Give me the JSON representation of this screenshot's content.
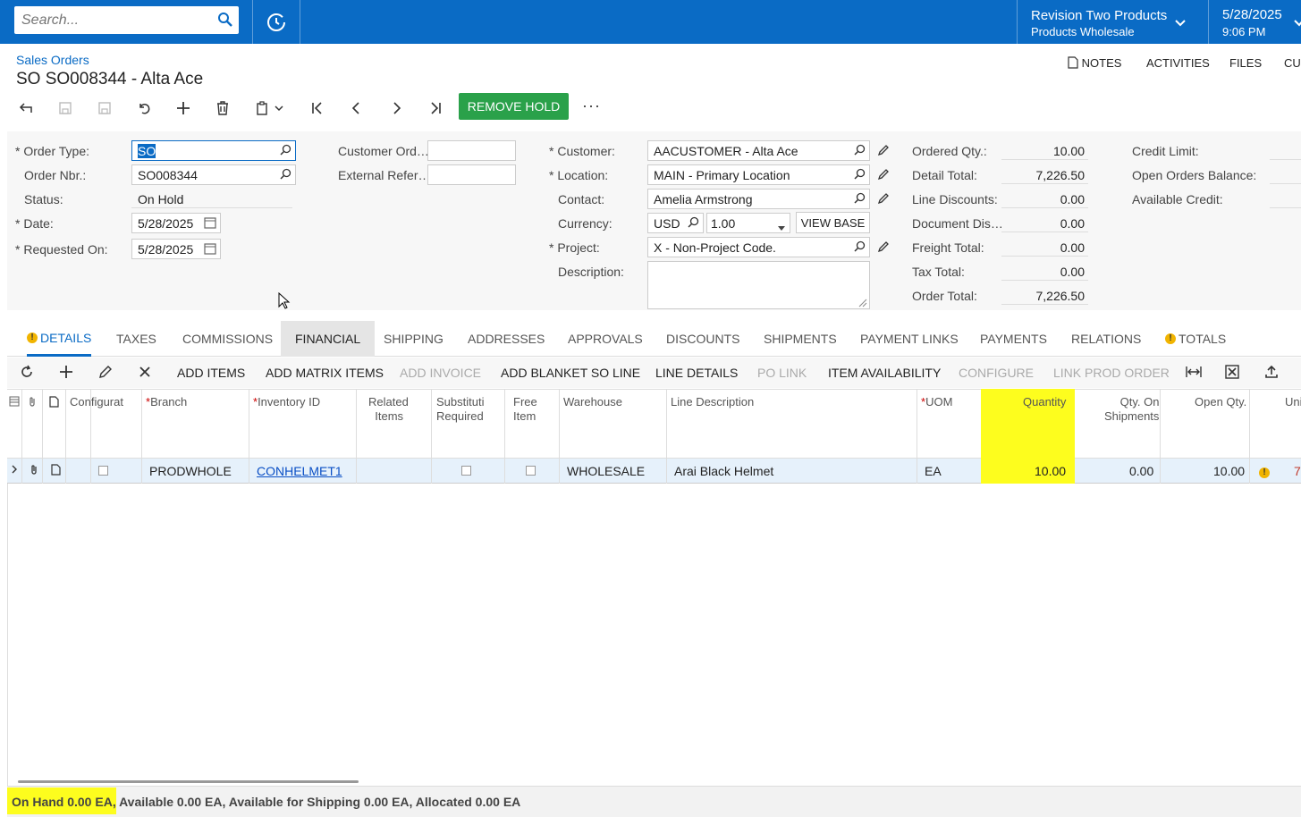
{
  "search": {
    "placeholder": "Search..."
  },
  "company": {
    "name": "Revision Two Products",
    "branch": "Products Wholesale"
  },
  "datetime": {
    "date": "5/28/2025",
    "time": "9:06 PM"
  },
  "breadcrumb": "Sales Orders",
  "page_title": "SO SO008344 - Alta Ace",
  "top_links": {
    "notes": "NOTES",
    "activities": "ACTIVITIES",
    "files": "FILES",
    "customization": "CU"
  },
  "toolbar": {
    "remove_hold": "REMOVE HOLD",
    "more": "···"
  },
  "form": {
    "order_type_label": "Order Type:",
    "order_type": "SO",
    "order_nbr_label": "Order Nbr.:",
    "order_nbr": "SO008344",
    "status_label": "Status:",
    "status": "On Hold",
    "date_label": "Date:",
    "date": "5/28/2025",
    "requested_label": "Requested On:",
    "requested": "5/28/2025",
    "customer_ord_label": "Customer Ord…",
    "external_ref_label": "External Refer…",
    "customer_label": "Customer:",
    "customer": "AACUSTOMER - Alta Ace",
    "location_label": "Location:",
    "location": "MAIN - Primary Location",
    "contact_label": "Contact:",
    "contact": "Amelia Armstrong",
    "currency_label": "Currency:",
    "currency": "USD",
    "rate": "1.00",
    "view_base": "VIEW BASE",
    "project_label": "Project:",
    "project": "X - Non-Project Code.",
    "description_label": "Description:",
    "ordered_qty_label": "Ordered Qty.:",
    "ordered_qty": "10.00",
    "detail_total_label": "Detail Total:",
    "detail_total": "7,226.50",
    "line_discounts_label": "Line Discounts:",
    "line_discounts": "0.00",
    "document_dis_label": "Document Dis…",
    "document_dis": "0.00",
    "freight_total_label": "Freight Total:",
    "freight_total": "0.00",
    "tax_total_label": "Tax Total:",
    "tax_total": "0.00",
    "order_total_label": "Order Total:",
    "order_total": "7,226.50",
    "credit_limit_label": "Credit Limit:",
    "open_orders_label": "Open Orders Balance:",
    "available_credit_label": "Available Credit:"
  },
  "tabs": [
    "DETAILS",
    "TAXES",
    "COMMISSIONS",
    "FINANCIAL",
    "SHIPPING",
    "ADDRESSES",
    "APPROVALS",
    "DISCOUNTS",
    "SHIPMENTS",
    "PAYMENT LINKS",
    "PAYMENTS",
    "RELATIONS",
    "TOTALS"
  ],
  "grid_toolbar": {
    "add_items": "ADD ITEMS",
    "add_matrix_items": "ADD MATRIX ITEMS",
    "add_invoice": "ADD INVOICE",
    "add_blanket": "ADD BLANKET SO LINE",
    "line_details": "LINE DETAILS",
    "po_link": "PO LINK",
    "item_availability": "ITEM AVAILABILITY",
    "configure": "CONFIGURE",
    "link_prod_order": "LINK PROD ORDER"
  },
  "grid_headers": {
    "configurat": "Configurat",
    "branch": "Branch",
    "inventory_id": "Inventory ID",
    "related_1": "Related",
    "related_2": "Items",
    "subst_1": "Substituti",
    "subst_2": "Required",
    "free_1": "Free",
    "free_2": "Item",
    "warehouse": "Warehouse",
    "line_description": "Line Description",
    "uom": "UOM",
    "quantity": "Quantity",
    "qty_ship_1": "Qty. On",
    "qty_ship_2": "Shipments",
    "open_qty": "Open Qty.",
    "uni": "Uni"
  },
  "grid_row": {
    "branch": "PRODWHOLE",
    "inventory_id": "CONHELMET1",
    "warehouse": "WHOLESALE",
    "line_description": "Arai Black Helmet",
    "uom": "EA",
    "quantity": "10.00",
    "qty_on_shipments": "0.00",
    "open_qty": "10.00",
    "unit_cut": "7"
  },
  "status_bar": {
    "on_hand": "On Hand 0.00 EA",
    "rest": ", Available 0.00 EA, Available for Shipping 0.00 EA, Allocated 0.00 EA"
  },
  "colors": {
    "topbar": "#0a6bc5",
    "hold_button": "#2aa14a",
    "highlight": "#fdfd1e"
  }
}
